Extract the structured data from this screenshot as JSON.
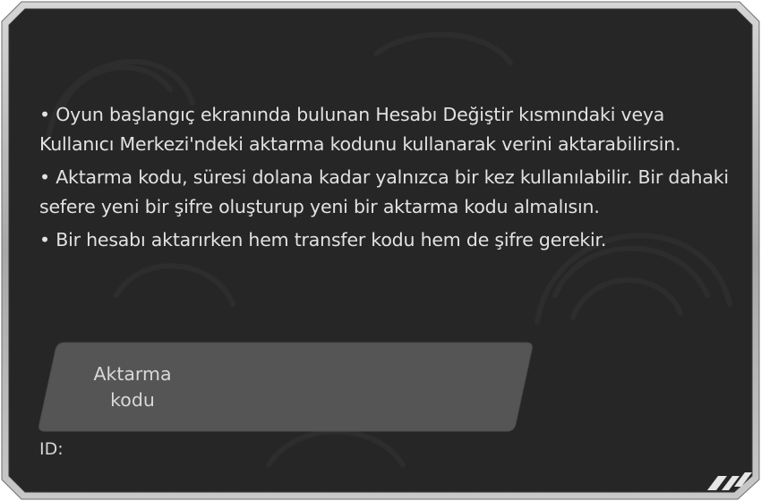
{
  "dialog": {
    "paragraphs": [
      "• Oyun başlangıç ekranında bulunan Hesabı Değiştir kısmındaki veya Kullanıcı Merkezi'ndeki aktarma kodunu kullanarak verini aktarabilirsin.",
      "• Aktarma kodu, süresi dolana kadar yalnızca bir kez kullanılabilir. Bir dahaki sefere yeni bir şifre oluşturup yeni bir aktarma kodu almalısın.",
      "• Bir hesabı aktarırken hem transfer kodu hem de şifre gerekir."
    ],
    "transfer_button": {
      "label": "Aktarma kodu"
    },
    "id_label": "ID:"
  },
  "colors": {
    "panel_bg": "#262626",
    "panel_border": "#b8b8b8",
    "button_bg": "#555555",
    "text": "#e2e2e2"
  },
  "icons": {
    "corner_ornament": "corner-stripes-icon",
    "background_pattern": "fingerprint-pattern-icon"
  }
}
